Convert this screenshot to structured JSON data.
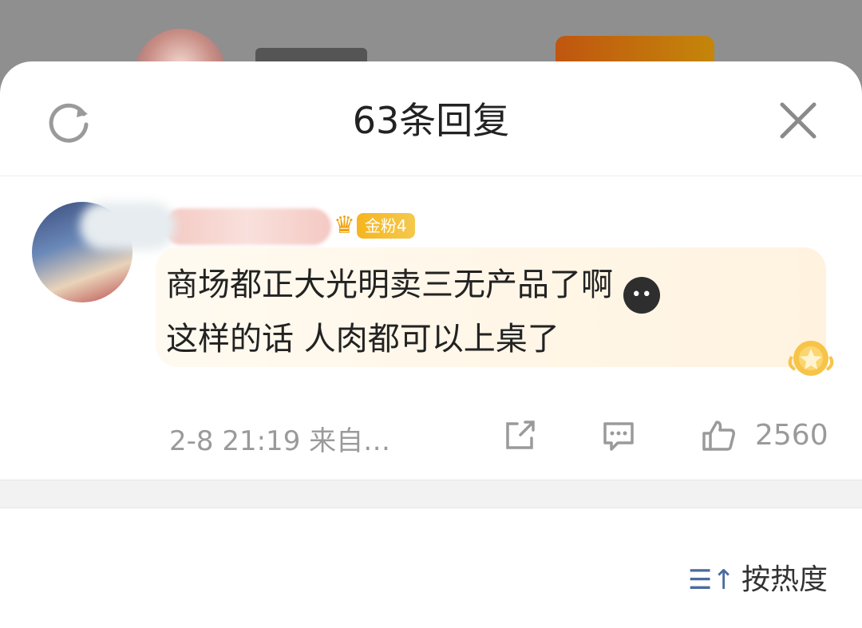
{
  "header": {
    "title": "63条回复"
  },
  "icons": {
    "refresh": "refresh-icon",
    "close": "close-icon",
    "crown": "crown-icon",
    "share": "share-icon",
    "comment": "comment-icon",
    "like": "thumbs-up-icon",
    "sort": "sort-icon"
  },
  "comment": {
    "badge": "金粉4",
    "line1": "商场都正大光明卖三无产品了啊",
    "line2": "这样的话 人肉都可以上桌了",
    "meta": "2-8 21:19  来自…",
    "likes": "2560"
  },
  "sort": {
    "label": "按热度"
  },
  "colors": {
    "badge": "#f6b51e",
    "sort_icon": "#4a6ba0",
    "meta_text": "#9a9a9a"
  }
}
